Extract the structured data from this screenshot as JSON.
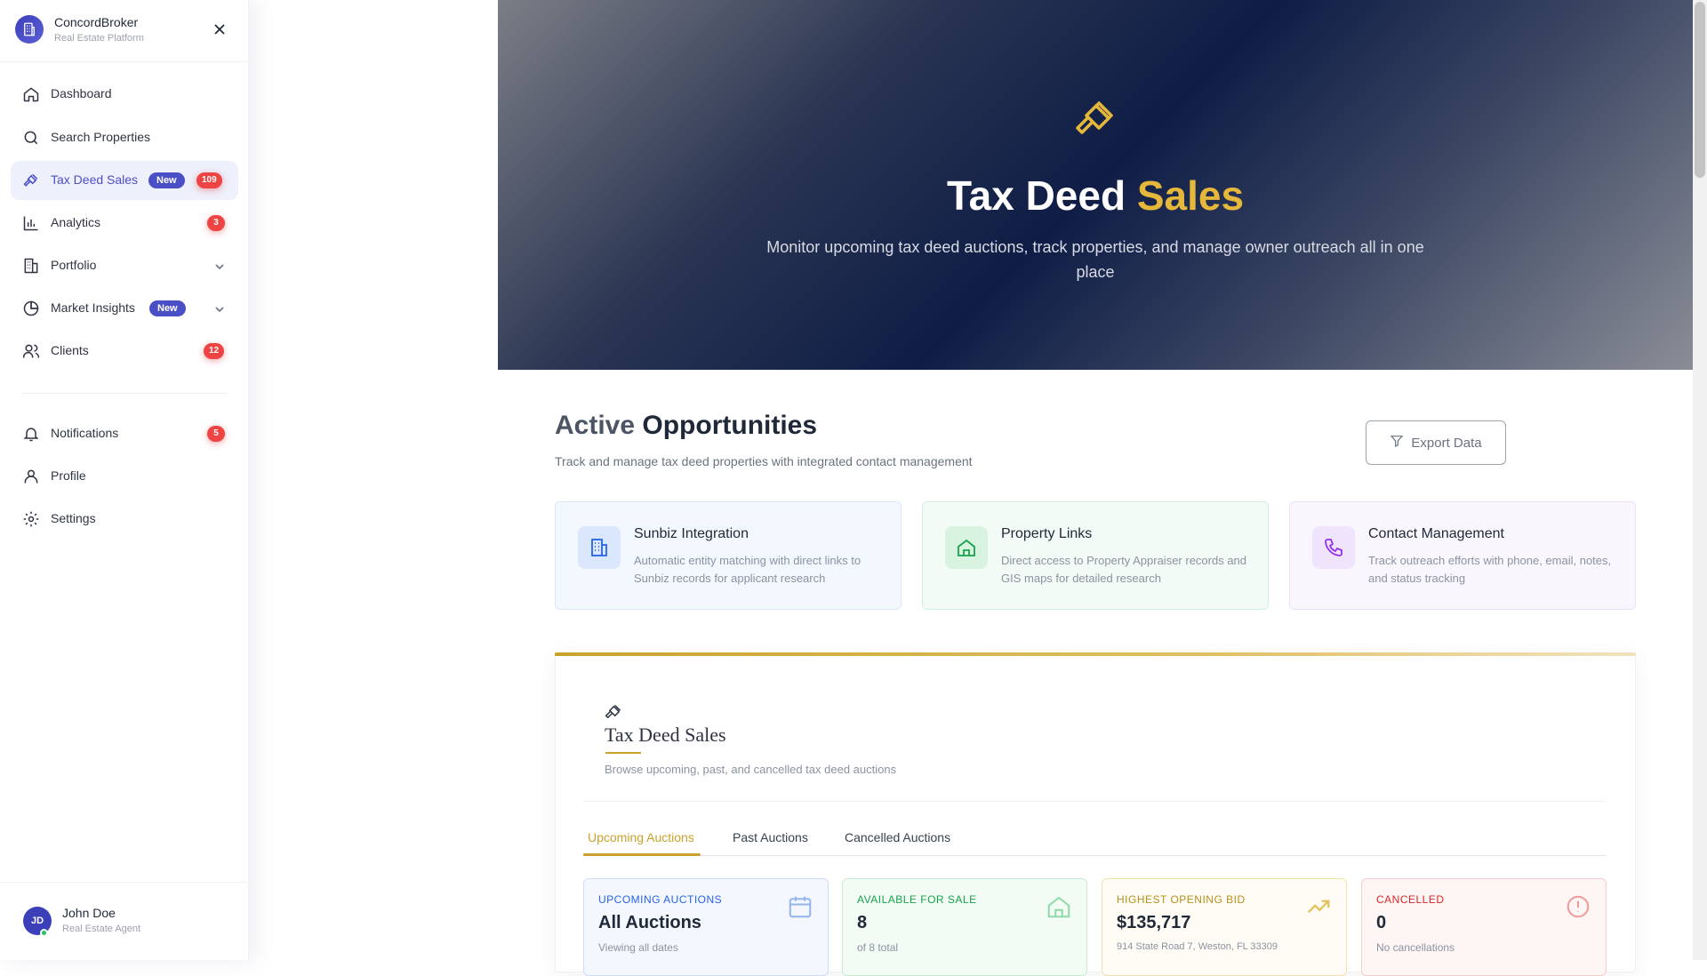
{
  "brand": {
    "name": "ConcordBroker",
    "subtitle": "Real Estate Platform"
  },
  "nav": {
    "items": [
      {
        "label": "Dashboard",
        "icon": "home-icon"
      },
      {
        "label": "Search Properties",
        "icon": "search-icon"
      },
      {
        "label": "Tax Deed Sales",
        "icon": "gavel-icon",
        "new_badge": "New",
        "count": "109",
        "active": true
      },
      {
        "label": "Analytics",
        "icon": "bar-chart-icon",
        "count": "3"
      },
      {
        "label": "Portfolio",
        "icon": "building-icon",
        "expandable": true
      },
      {
        "label": "Market Insights",
        "icon": "pie-chart-icon",
        "new_badge": "New",
        "expandable": true
      },
      {
        "label": "Clients",
        "icon": "users-icon",
        "count": "12"
      }
    ],
    "secondary": [
      {
        "label": "Notifications",
        "icon": "bell-icon",
        "count": "5"
      },
      {
        "label": "Profile",
        "icon": "user-icon"
      },
      {
        "label": "Settings",
        "icon": "gear-icon"
      }
    ]
  },
  "user": {
    "initials": "JD",
    "name": "John Doe",
    "role": "Real Estate Agent"
  },
  "hero": {
    "title_main": "Tax Deed",
    "title_accent": "Sales",
    "subtitle": "Monitor upcoming tax deed auctions, track properties, and manage owner outreach all in one place"
  },
  "opportunities": {
    "title_light": "Active",
    "title_strong": "Opportunities",
    "subtitle": "Track and manage tax deed properties with integrated contact management",
    "export_label": "Export Data"
  },
  "features": [
    {
      "title": "Sunbiz Integration",
      "desc": "Automatic entity matching with direct links to Sunbiz records for applicant research"
    },
    {
      "title": "Property Links",
      "desc": "Direct access to Property Appraiser records and GIS maps for detailed research"
    },
    {
      "title": "Contact Management",
      "desc": "Track outreach efforts with phone, email, notes, and status tracking"
    }
  ],
  "panel": {
    "title": "Tax Deed Sales",
    "subtitle": "Browse upcoming, past, and cancelled tax deed auctions",
    "tabs": [
      "Upcoming Auctions",
      "Past Auctions",
      "Cancelled Auctions"
    ]
  },
  "stats": [
    {
      "label": "UPCOMING AUCTIONS",
      "value": "All Auctions",
      "note": "Viewing all dates",
      "color": "#2563eb"
    },
    {
      "label": "AVAILABLE FOR SALE",
      "value": "8",
      "note": "of 8 total",
      "color": "#16a34a"
    },
    {
      "label": "HIGHEST OPENING BID",
      "value": "$135,717",
      "note": "914 State Road 7, Weston, FL 33309",
      "color": "#c9a22e"
    },
    {
      "label": "CANCELLED",
      "value": "0",
      "note": "No cancellations",
      "color": "#dc2626"
    }
  ],
  "colors": {
    "accent_gold": "#c9a22e",
    "brand_indigo": "#4b4fc6",
    "badge_red": "#ef4444"
  }
}
